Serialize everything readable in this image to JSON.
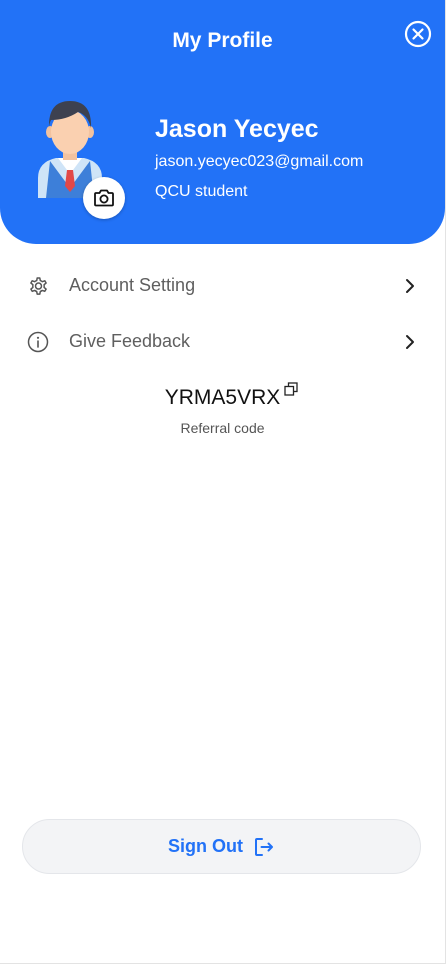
{
  "header": {
    "title": "My Profile",
    "close_icon": "close-circle-icon",
    "background_color": "#2272f7"
  },
  "profile": {
    "name": "Jason Yecyec",
    "email": "jason.yecyec023@gmail.com",
    "role": "QCU student",
    "avatar_icon": "student-avatar-icon",
    "camera_icon": "camera-icon"
  },
  "menu": {
    "items": [
      {
        "label": "Account Setting",
        "icon": "gear-icon"
      },
      {
        "label": "Give Feedback",
        "icon": "info-icon"
      }
    ],
    "chevron_icon": "chevron-right-icon"
  },
  "referral": {
    "code": "YRMA5VRX",
    "label": "Referral code",
    "copy_icon": "copy-icon"
  },
  "sign_out": {
    "label": "Sign Out",
    "icon": "sign-out-icon",
    "color": "#2272f7"
  }
}
